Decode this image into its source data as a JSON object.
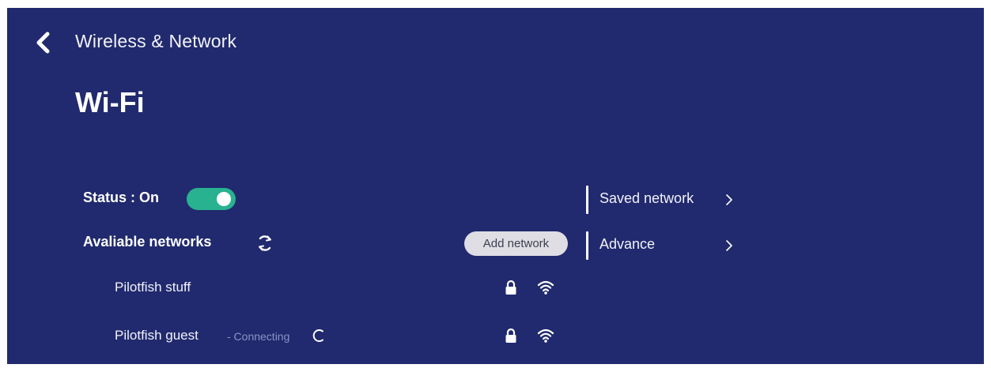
{
  "header": {
    "back_icon": "chevron-left-icon",
    "title": "Wireless & Network"
  },
  "page_title": "Wi-Fi",
  "status": {
    "label": "Status : On",
    "toggle_on": true,
    "toggle_color": "#28b28f"
  },
  "available": {
    "label": "Avaliable networks",
    "refresh_icon": "refresh-icon"
  },
  "add_network_label": "Add network",
  "networks": [
    {
      "name": "Pilotfish stuff",
      "status": "",
      "secured": true,
      "signal_icon": "wifi-icon"
    },
    {
      "name": "Pilotfish guest",
      "status": "- Connecting",
      "secured": true,
      "signal_icon": "wifi-icon",
      "connecting_icon": "spinner-icon"
    }
  ],
  "side_menu": [
    {
      "label": "Saved network",
      "icon": "chevron-right-icon"
    },
    {
      "label": "Advance",
      "icon": "chevron-right-icon"
    }
  ],
  "colors": {
    "background": "#212a6e",
    "accent": "#28b28f",
    "button_bg": "#dedee4"
  }
}
